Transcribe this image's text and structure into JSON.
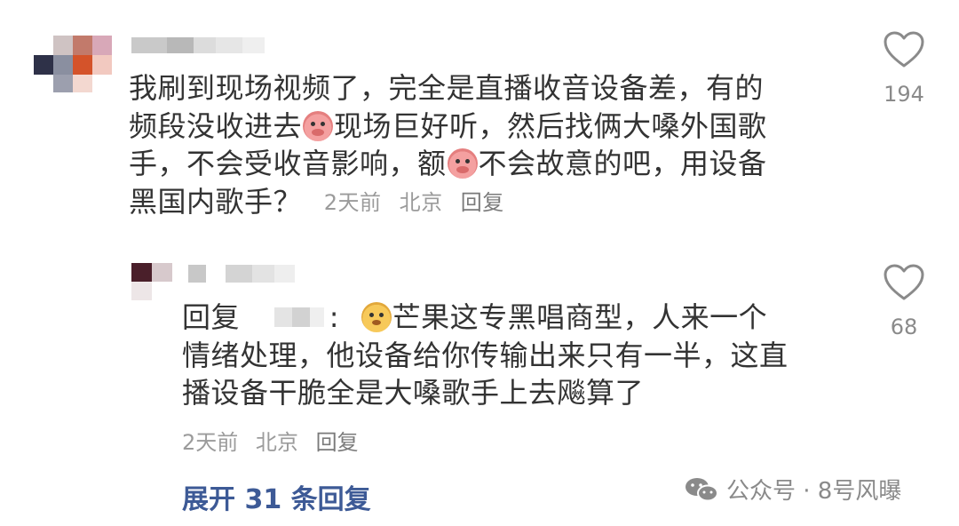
{
  "comments": [
    {
      "lines": [
        [
          "我刷到现场视频了，完全是直播收音设备差，有的"
        ],
        [
          "频段没收进去",
          "{pig}",
          "现场巨好听，然后找俩大嗓外国歌"
        ],
        [
          "手，不会受收音影响，额",
          "{pig}",
          "不会故意的吧，用设备"
        ],
        [
          "黑国内歌手？"
        ]
      ],
      "time": "2天前",
      "location": "北京",
      "reply_label": "回复",
      "like_count": "194"
    },
    {
      "reply_prefix": "回复",
      "reply_colon": ":",
      "lines": [
        [
          "{dog}",
          "芒果这专黑唱商型，人来一个"
        ],
        [
          "情绪处理，他设备给你传输出来只有一半，这直"
        ],
        [
          "播设备干脆全是大嗓歌手上去飚算了"
        ]
      ],
      "time": "2天前",
      "location": "北京",
      "reply_label": "回复",
      "like_count": "68"
    }
  ],
  "expand_label": "展开 31 条回复",
  "watermark": {
    "text": "公众号 · 8号风曝",
    "icon": "wechat-icon"
  },
  "icons": {
    "like": "heart-outline-icon"
  },
  "colors": {
    "text": "#333333",
    "meta": "#9b9b9b",
    "link": "#3d5a96"
  }
}
